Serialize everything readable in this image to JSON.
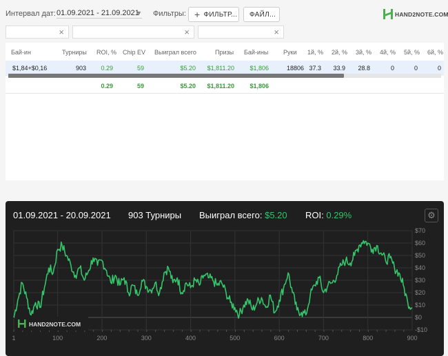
{
  "toolbar": {
    "interval_label": "Интервал дат:",
    "date_range": "01.09.2021 - 21.09.2021",
    "filters_label": "Фильтры:",
    "filter_button": "ФИЛЬТР...",
    "file_button": "ФАЙЛ..."
  },
  "brand": {
    "logo_text": "HAND2NOTE.COM"
  },
  "table": {
    "headers": [
      "Бай-ин",
      "Турниры",
      "ROI, %",
      "Chip EV",
      "Выиграл всего",
      "Призы",
      "Бай-ины",
      "Руки",
      "1й, %",
      "2й, %",
      "3й, %",
      "4й, %",
      "5й, %",
      "6й, %"
    ],
    "rows": [
      [
        "$1,84+$0,16",
        "903",
        "0.29",
        "59",
        "$5.20",
        "$1,811.20",
        "$1,806",
        "18806",
        "37.3",
        "33.9",
        "28.8",
        "0",
        "0",
        "0"
      ]
    ],
    "totals": [
      "",
      "",
      "0.29",
      "59",
      "$5.20",
      "$1,811.20",
      "$1,806",
      "",
      "",
      "",
      "",
      "",
      "",
      ""
    ]
  },
  "chart_header": {
    "date_range": "01.09.2021 - 20.09.2021",
    "tournaments": "903 Турниры",
    "won_label": "Выиграл всего:",
    "won_value": "$5.20",
    "roi_label": "ROI:",
    "roi_value": "0.29%"
  },
  "colors": {
    "accent": "#35c46a",
    "chart_bg": "#1f1f1f",
    "table_highlight": "#e8f1fb"
  },
  "chart_data": {
    "type": "line",
    "xlabel": "",
    "ylabel": "",
    "xlim": [
      1,
      900
    ],
    "ylim": [
      -10,
      70
    ],
    "x_ticks": [
      1,
      100,
      200,
      300,
      400,
      500,
      600,
      700,
      800,
      900
    ],
    "y_ticks": [
      "$70",
      "$60",
      "$50",
      "$40",
      "$30",
      "$20",
      "$10",
      "$0",
      "-$10"
    ],
    "y_tick_values": [
      70,
      60,
      50,
      40,
      30,
      20,
      10,
      0,
      -10
    ],
    "grid": true,
    "series": [
      {
        "color": "#35c46a",
        "x": [
          1,
          10,
          20,
          30,
          40,
          50,
          60,
          70,
          80,
          90,
          100,
          110,
          120,
          130,
          140,
          150,
          160,
          170,
          180,
          190,
          200,
          210,
          220,
          230,
          240,
          250,
          260,
          270,
          280,
          290,
          300,
          310,
          320,
          330,
          340,
          350,
          360,
          370,
          380,
          390,
          400,
          410,
          420,
          430,
          440,
          450,
          460,
          470,
          480,
          490,
          500,
          510,
          520,
          530,
          540,
          550,
          560,
          570,
          580,
          590,
          600,
          610,
          620,
          630,
          640,
          650,
          660,
          670,
          680,
          690,
          700,
          710,
          720,
          730,
          740,
          750,
          760,
          770,
          780,
          790,
          800,
          810,
          820,
          830,
          840,
          850,
          860,
          870,
          880,
          890,
          900
        ],
        "y": [
          0,
          14,
          28,
          16,
          2,
          12,
          8,
          24,
          40,
          36,
          55,
          58,
          50,
          42,
          34,
          40,
          30,
          38,
          48,
          42,
          46,
          38,
          28,
          34,
          26,
          32,
          20,
          26,
          18,
          30,
          25,
          22,
          28,
          20,
          36,
          40,
          28,
          32,
          20,
          28,
          24,
          30,
          26,
          34,
          32,
          30,
          26,
          28,
          20,
          12,
          8,
          2,
          10,
          14,
          6,
          12,
          16,
          8,
          18,
          4,
          14,
          24,
          36,
          20,
          6,
          4,
          2,
          18,
          26,
          32,
          20,
          26,
          28,
          34,
          42,
          46,
          44,
          50,
          58,
          62,
          60,
          55,
          58,
          52,
          46,
          48,
          40,
          36,
          26,
          12,
          8
        ]
      }
    ]
  }
}
